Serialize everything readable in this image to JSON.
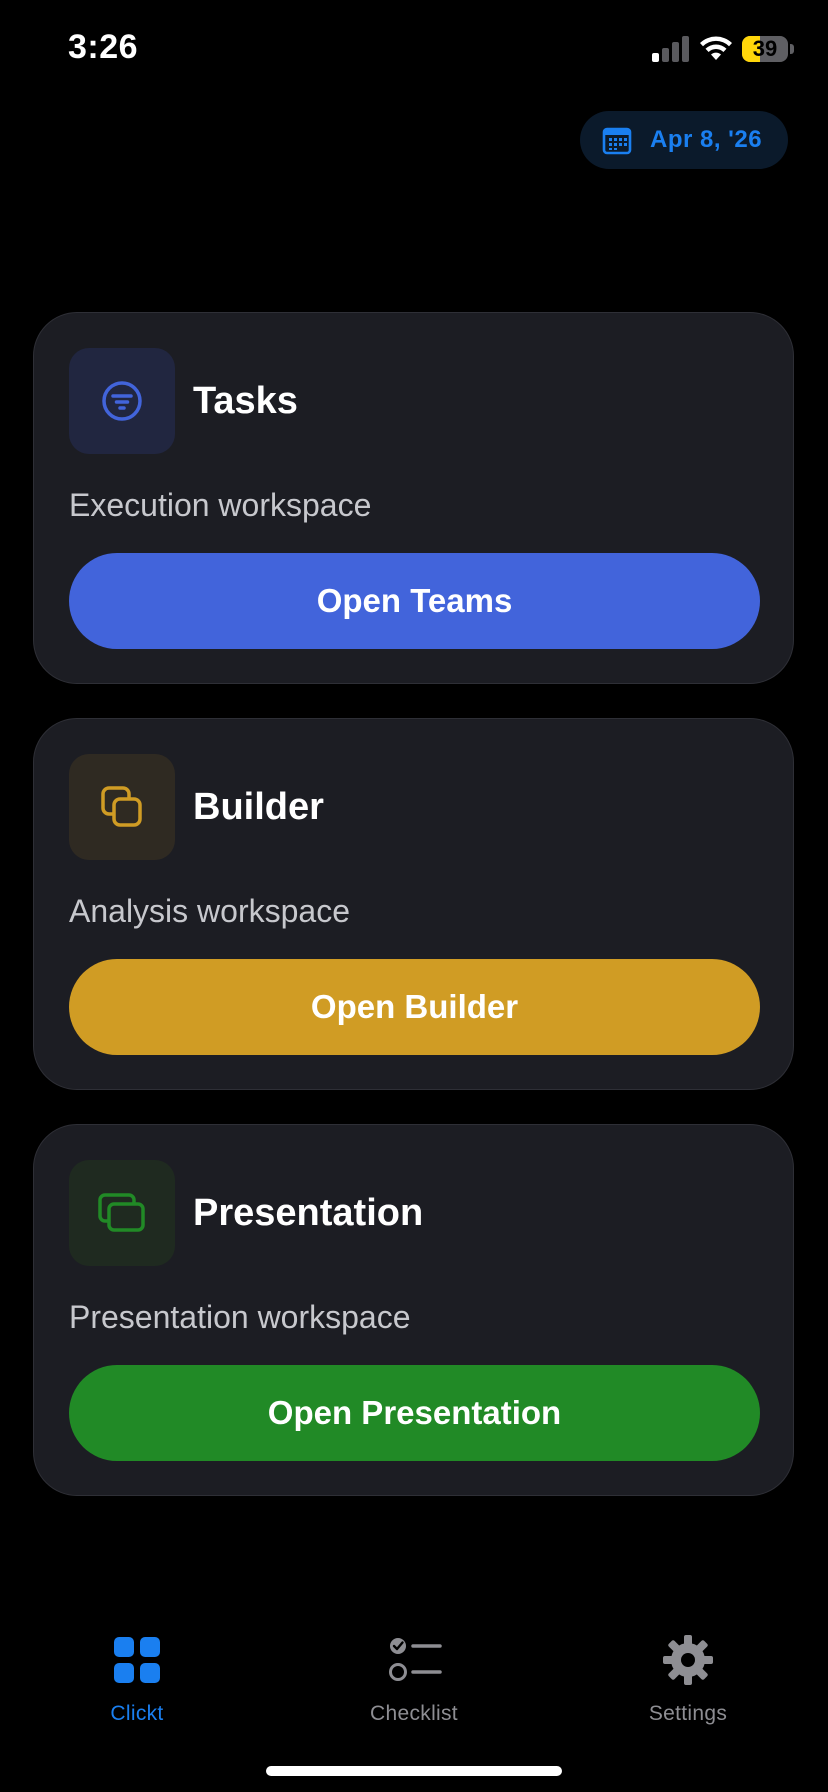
{
  "status_bar": {
    "time": "3:26",
    "battery_level": "39",
    "battery_fraction": 0.39,
    "signal_bars_active": 1,
    "signal_bars_total": 4
  },
  "date_button": {
    "label": "Apr 8, '26",
    "icon": "calendar-icon",
    "color": "#1a7ff0"
  },
  "cards": [
    {
      "title": "Tasks",
      "subtitle": "Execution workspace",
      "button_label": "Open Teams",
      "icon": "filter-circle-icon",
      "accent": "#4264db",
      "icon_bg": "#212640"
    },
    {
      "title": "Builder",
      "subtitle": "Analysis workspace",
      "button_label": "Open Builder",
      "icon": "copy-squares-icon",
      "accent": "#d09c24",
      "icon_bg": "#2f2a22"
    },
    {
      "title": "Presentation",
      "subtitle": "Presentation workspace",
      "button_label": "Open Presentation",
      "icon": "stacked-windows-icon",
      "accent": "#218a26",
      "icon_bg": "#1f2a20"
    }
  ],
  "tab_bar": {
    "tabs": [
      {
        "label": "Clickt",
        "icon": "grid-icon",
        "active": true
      },
      {
        "label": "Checklist",
        "icon": "checklist-icon",
        "active": false
      },
      {
        "label": "Settings",
        "icon": "gear-icon",
        "active": false
      }
    ],
    "active_color": "#1a7ff0",
    "inactive_color": "#8e8e93"
  }
}
